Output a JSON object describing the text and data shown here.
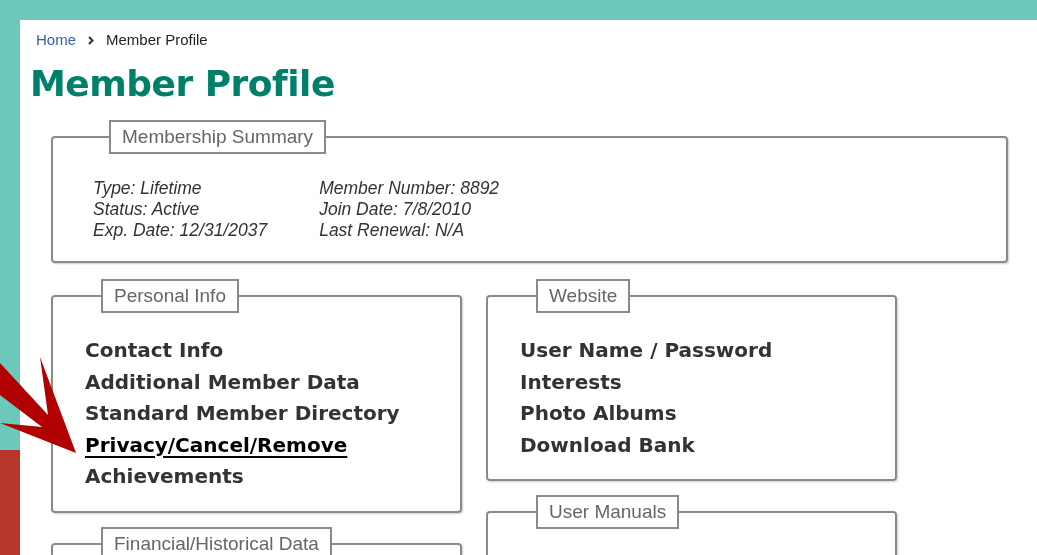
{
  "breadcrumb": [
    {
      "label": "Home",
      "link": true
    },
    {
      "label": "Member Profile",
      "link": false
    }
  ],
  "page_title": "Member Profile",
  "summary": {
    "legend": "Membership Summary",
    "columns": [
      [
        "Type: Lifetime",
        "Status: Active",
        "Exp. Date: 12/31/2037"
      ],
      [
        "Member Number: 8892",
        "Join Date: 7/8/2010",
        "Last Renewal: N/A"
      ]
    ]
  },
  "columns": [
    [
      {
        "legend": "Personal Info",
        "links": [
          {
            "label": "Contact Info",
            "hovered": false
          },
          {
            "label": "Additional Member Data",
            "hovered": false
          },
          {
            "label": "Standard Member Directory",
            "hovered": false
          },
          {
            "label": "Privacy/Cancel/Remove",
            "hovered": true
          },
          {
            "label": "Achievements",
            "hovered": false
          }
        ]
      },
      {
        "legend": "Financial/Historical Data"
      }
    ],
    [
      {
        "legend": "Website",
        "links": [
          {
            "label": "User Name / Password",
            "hovered": false
          },
          {
            "label": "Interests",
            "hovered": false
          },
          {
            "label": "Photo Albums",
            "hovered": false
          },
          {
            "label": "Download Bank",
            "hovered": false
          }
        ]
      },
      {
        "legend": "User Manuals"
      }
    ]
  ]
}
